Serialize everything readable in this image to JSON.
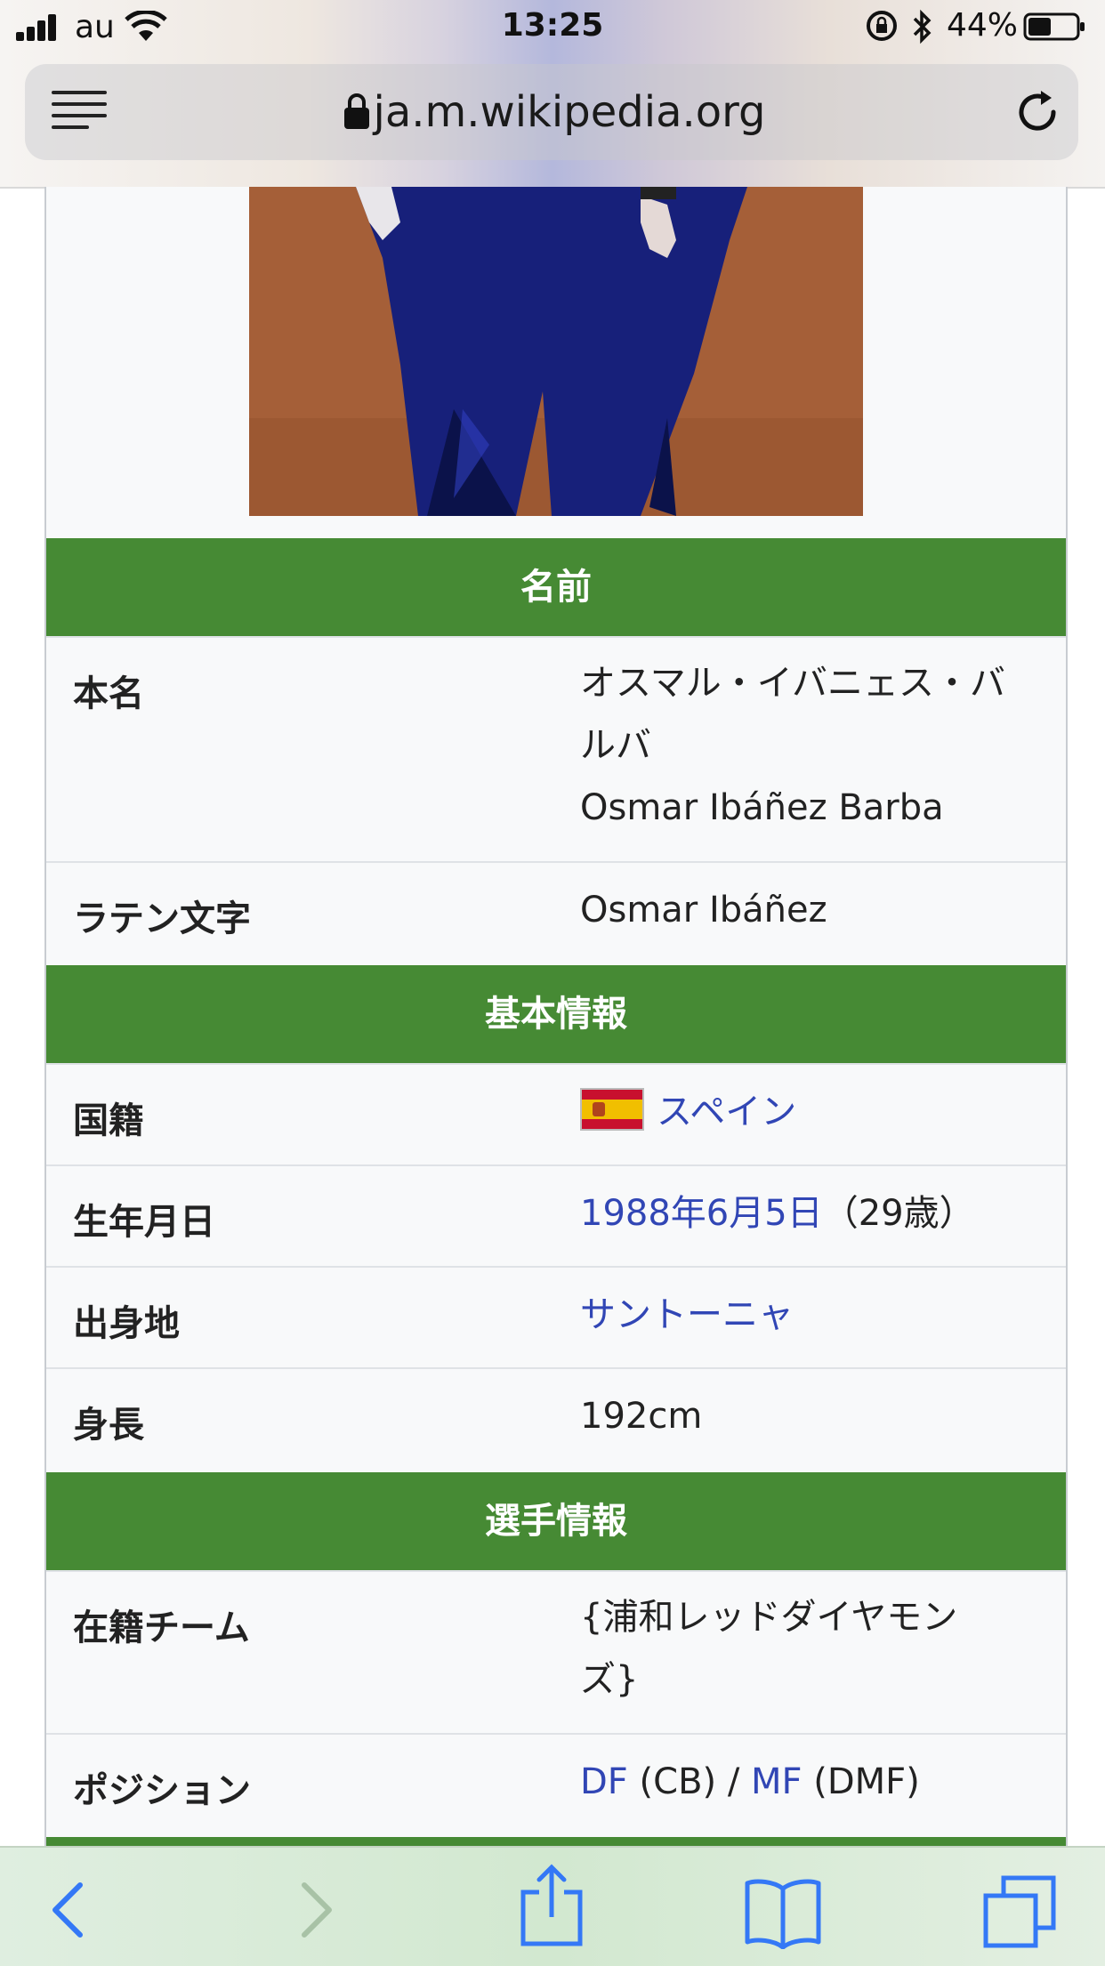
{
  "status_bar": {
    "carrier": "au",
    "time": "13:25",
    "battery_percent": "44%",
    "battery_level": 0.44
  },
  "address_bar": {
    "url": "ja.m.wikipedia.org"
  },
  "infobox": {
    "sections": [
      {
        "title": "名前"
      },
      {
        "title": "基本情報"
      },
      {
        "title": "選手情報"
      }
    ],
    "rows": {
      "real_name": {
        "label": "本名",
        "value_ja_1": "オスマル・イバニェス・バ",
        "value_ja_2": "ルバ",
        "value_latin": "Osmar Ibáñez Barba"
      },
      "latin": {
        "label": "ラテン文字",
        "value": "Osmar Ibáñez"
      },
      "nationality": {
        "label": "国籍",
        "value": "スペイン"
      },
      "birth": {
        "label": "生年月日",
        "date": "1988年6月5日",
        "age": "（29歳）"
      },
      "birthplace": {
        "label": "出身地",
        "value": "サントーニャ"
      },
      "height": {
        "label": "身長",
        "value": "192cm"
      },
      "team": {
        "label": "在籍チーム",
        "value_1": "{浦和レッドダイヤモン",
        "value_2": "ズ}"
      },
      "position": {
        "label": "ポジション",
        "df": "DF",
        "df_detail": " (CB) / ",
        "mf": "MF",
        "mf_detail": " (DMF)"
      }
    }
  },
  "colors": {
    "section_header": "#468a34",
    "link": "#3146b5",
    "ios_blue": "#3478f6"
  },
  "toolbar": {
    "icons": [
      "back-icon",
      "forward-icon",
      "share-icon",
      "bookmarks-icon",
      "tabs-icon"
    ]
  }
}
